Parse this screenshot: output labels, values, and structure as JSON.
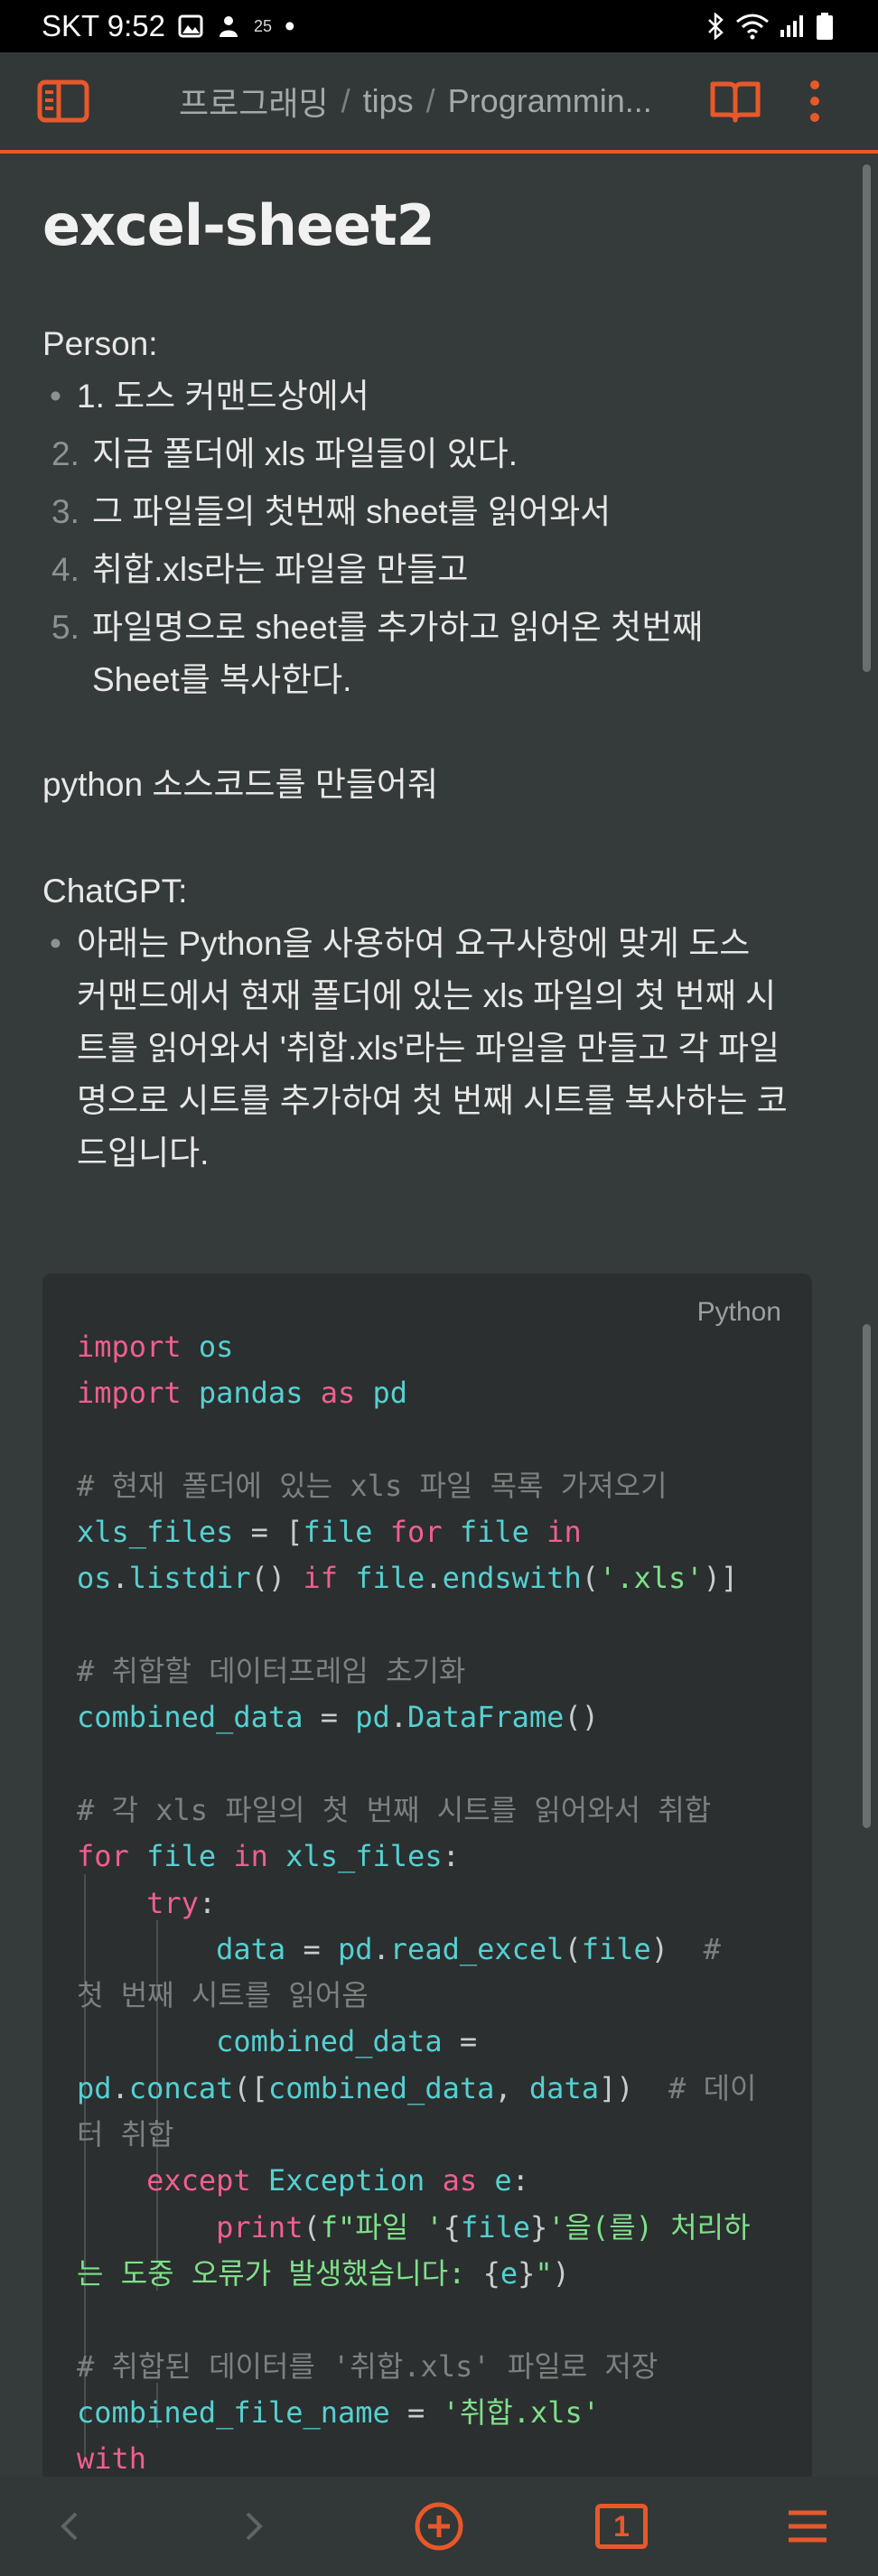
{
  "status": {
    "carrier_time": "SKT 9:52",
    "small_text": "25",
    "dot": "•"
  },
  "appbar": {
    "breadcrumb": [
      "프로그래밍",
      "tips",
      "Programmin..."
    ],
    "accent": "#e8582a"
  },
  "page": {
    "title": "excel-sheet2",
    "person_label": "Person:",
    "person_items": [
      {
        "marker": "•",
        "text": "1. 도스 커맨드상에서"
      },
      {
        "marker": "2.",
        "text": "지금 폴더에 xls 파일들이 있다."
      },
      {
        "marker": "3.",
        "text": "그 파일들의 첫번째 sheet를 읽어와서"
      },
      {
        "marker": "4.",
        "text": "취합.xls라는 파일을 만들고"
      },
      {
        "marker": "5.",
        "text": "파일명으로 sheet를 추가하고 읽어온 첫번째",
        "text2": "Sheet를 복사한다."
      }
    ],
    "request": "python 소스코드를 만들어줘",
    "chatgpt_label": "ChatGPT:",
    "chatgpt_lines": [
      "아래는 Python을 사용하여 요구사항에 맞게 도스",
      "커맨드에서 현재 폴더에 있는 xls 파일의 첫 번째 시",
      "트를 읽어와서 '취합.xls'라는 파일을 만들고 각 파일",
      "명으로 시트를 추가하여 첫 번째 시트를 복사하는 코",
      "드입니다."
    ],
    "chatgpt_marker": "•"
  },
  "code": {
    "language": "Python",
    "lines": [
      "import os",
      "import pandas as pd",
      "",
      "# 현재 폴더에 있는 xls 파일 목록 가져오기",
      "xls_files = [file for file in",
      "os.listdir() if file.endswith('.xls')]",
      "",
      "# 취합할 데이터프레임 초기화",
      "combined_data = pd.DataFrame()",
      "",
      "# 각 xls 파일의 첫 번째 시트를 읽어와서 취합",
      "for file in xls_files:",
      "    try:",
      "        data = pd.read_excel(file)  #",
      "첫 번째 시트를 읽어옴",
      "        combined_data =",
      "pd.concat([combined_data, data])  # 데이",
      "터 취합",
      "    except Exception as e:",
      "        print(f\"파일 '{file}'을(를) 처리하",
      "는 도중 오류가 발생했습니다: {e}\")",
      "",
      "# 취합된 데이터를 '취합.xls' 파일로 저장",
      "combined_file_name = '취합.xls'",
      "with"
    ]
  },
  "bottom": {
    "tab_count": "1",
    "back_label": "<",
    "forward_label": ">"
  },
  "colors": {
    "background": "#353b3a",
    "code_bg": "#2b2f2f",
    "keyword": "#ef5f8f",
    "variable": "#56d0d2",
    "string": "#7fe08a",
    "comment": "#7c8180"
  }
}
